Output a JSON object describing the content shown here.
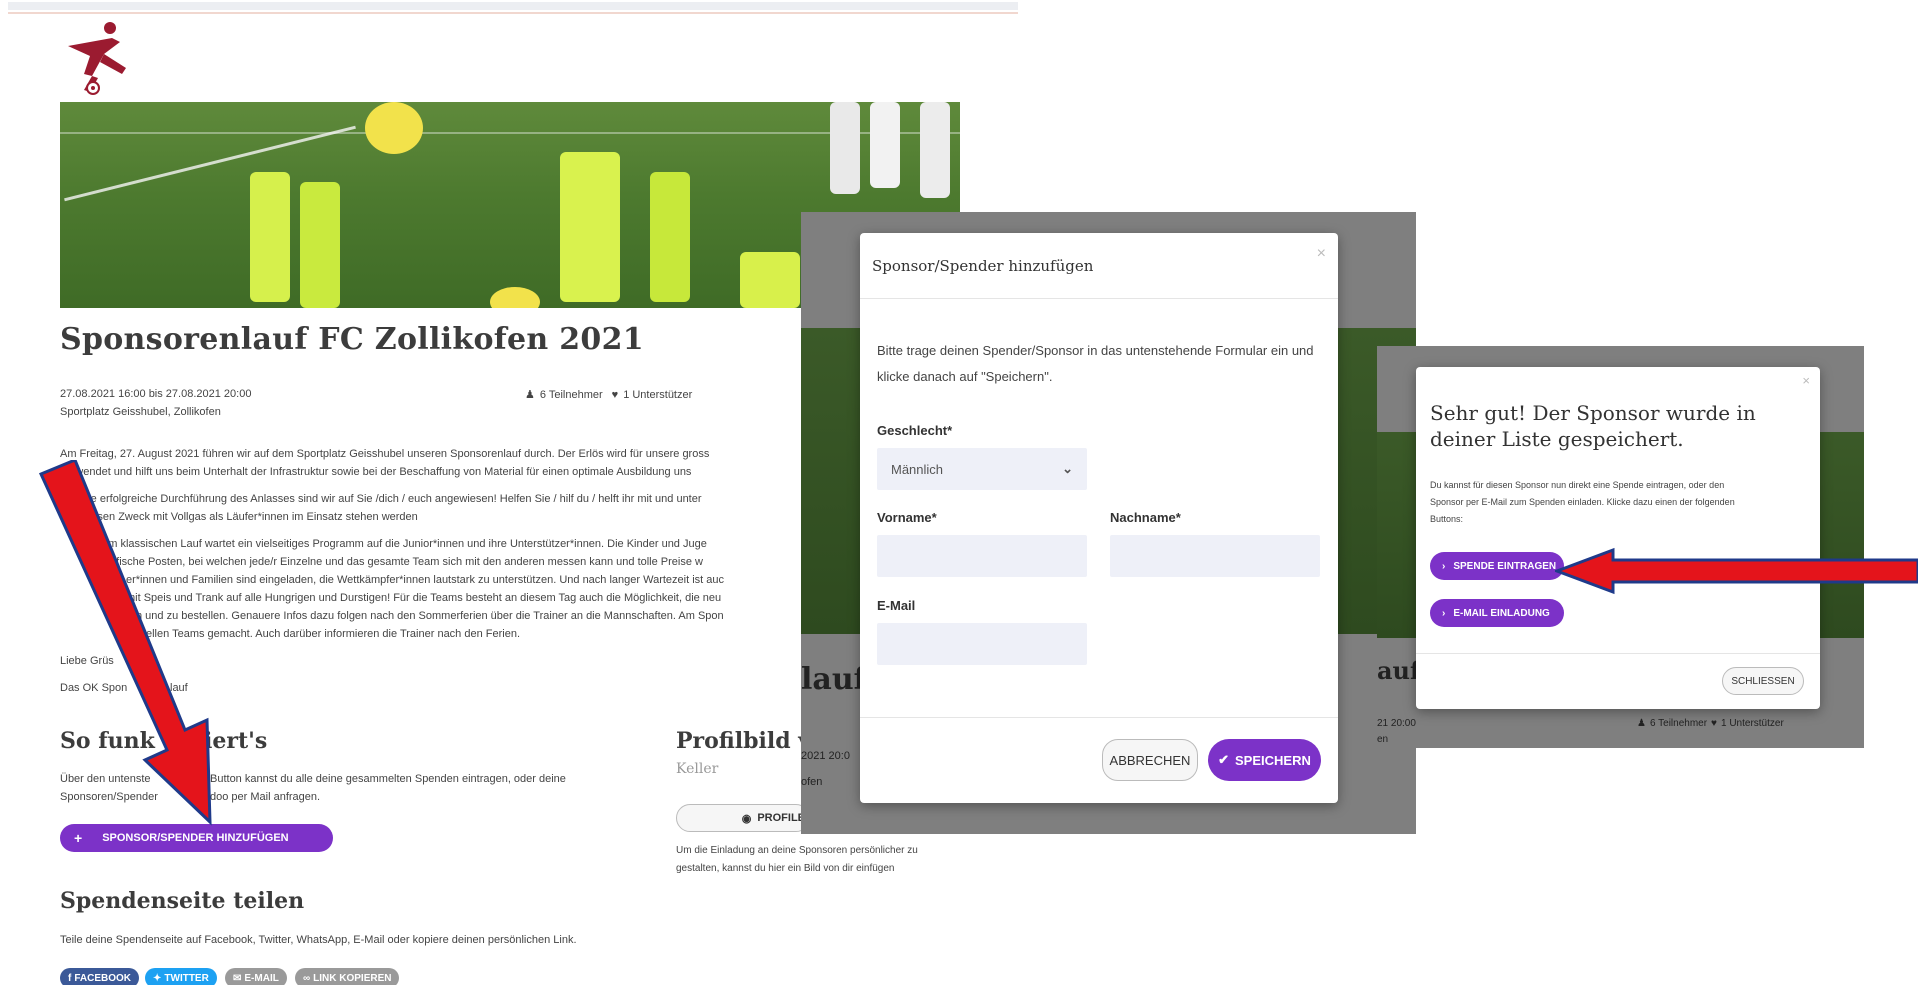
{
  "page": {
    "title": "Sponsorenlauf FC Zollikofen 2021",
    "date_range": "27.08.2021 16:00 bis 27.08.2021 20:00",
    "location": "Sportplatz Geisshubel, Zollikofen",
    "participants": "6 Teilnehmer",
    "supporters": "1 Unterstützer",
    "paragraphs": [
      "Am Freitag, 27. August 2021 führen wir auf dem Sportplatz Geisshubel unseren Sponsorenlauf durch. Der Erlös wird für unsere gross",
      "verwendet und hilft uns beim Unterhalt der Infrastruktur sowie bei der Beschaffung von Material für einen optimale Ausbildung uns",
      "eine erfolgreiche Durchführung des Anlasses sind wir auf Sie /dich / euch angewiesen! Helfen Sie / hilf du / helft ihr mit und unter",
      "r diesen Zweck mit Vollgas als Läufer*innen im Einsatz stehen werden",
      "dem klassischen Lauf wartet ein vielseitiges Programm auf die Junior*innen und ihre Unterstützer*innen. Die Kinder und Juge",
      "pezifische Posten, bei welchen jede/r Einzelne und das gesamte Team sich mit den anderen messen kann und tolle Preise w",
      "er*innen und Familien sind eingeladen, die Wettkämpfer*innen lautstark zu unterstützen. Und nach langer Wartezeit ist auc",
      "mit Speis und Trank auf alle Hungrigen und Durstigen! Für die Teams besteht an diesem Tag auch die Möglichkeit, die neu",
      "n und zu bestellen. Genauere Infos dazu folgen nach den Sommerferien über die Trainer an die Mannschaften. Am Spon",
      "ellen Teams gemacht. Auch darüber informieren die Trainer nach den Ferien."
    ],
    "greeting": "Liebe Grüs",
    "signature": "Das OK Spon",
    "signature_end": "lauf"
  },
  "how_it_works": {
    "heading": "So funk",
    "heading_end": "niert's",
    "text_line1": "Über den untenste",
    "text_line1_end": "Button kannst du alle deine gesammelten Spenden eintragen, oder deine",
    "text_line2": "Sponsoren/Spender",
    "text_line2_end": "doo per Mail anfragen.",
    "add_button": "SPONSOR/SPENDER HINZUFÜGEN"
  },
  "profile": {
    "heading": "Profilbild v",
    "name": "Keller",
    "button": "PROFILE",
    "hint_line1": "Um die Einladung an deine Sponsoren persönlicher zu",
    "hint_line2": "gestalten, kannst du hier ein Bild von dir einfügen"
  },
  "share": {
    "heading": "Spendenseite teilen",
    "text": "Teile deine Spendenseite auf Facebook, Twitter, WhatsApp, E-Mail oder kopiere deinen persönlichen Link.",
    "buttons": [
      {
        "label": "FACEBOOK",
        "icon": "facebook-icon",
        "color": "#3b5998"
      },
      {
        "label": "TWITTER",
        "icon": "twitter-icon",
        "color": "#1da1f2"
      },
      {
        "label": "E-MAIL",
        "icon": "mail-icon",
        "color": "#9a9a9a"
      },
      {
        "label": "LINK KOPIEREN",
        "icon": "link-icon",
        "color": "#9a9a9a"
      }
    ]
  },
  "modal1": {
    "title": "Sponsor/Spender hinzufügen",
    "intro_line1": "Bitte trage deinen Spender/Sponsor in das untenstehende Formular ein und",
    "intro_line2": "klicke danach auf \"Speichern\".",
    "gender_label": "Geschlecht*",
    "gender_value": "Männlich",
    "firstname_label": "Vorname*",
    "lastname_label": "Nachname*",
    "email_label": "E-Mail",
    "cancel": "ABBRECHEN",
    "save": "SPEICHERN",
    "bg_title_fragment": "lauf",
    "bg_time_fragment": "2021 20:0",
    "bg_place_fragment": "ofen"
  },
  "modal2": {
    "title_line1": "Sehr gut! Der Sponsor wurde in",
    "title_line2": "deiner Liste gespeichert.",
    "text_line1": "Du kannst für diesen Sponsor nun direkt eine Spende eintragen, oder den",
    "text_line2": "Sponsor per E-Mail zum Spenden einladen. Klicke dazu einen der folgenden",
    "text_line3": "Buttons:",
    "donate_button": "SPENDE EINTRAGEN",
    "invite_button": "E-MAIL EINLADUNG",
    "close_button": "SCHLIESSEN",
    "bg_title_fragment": "auf",
    "bg_time_fragment": "21 20:00",
    "bg_place_fragment": "en",
    "bg_participants": "6 Teilnehmer",
    "bg_supporters": "1 Unterstützer"
  },
  "colors": {
    "accent": "#7c32c8",
    "arrow": "#e4141b",
    "arrow_outline": "#1f3a8a"
  }
}
